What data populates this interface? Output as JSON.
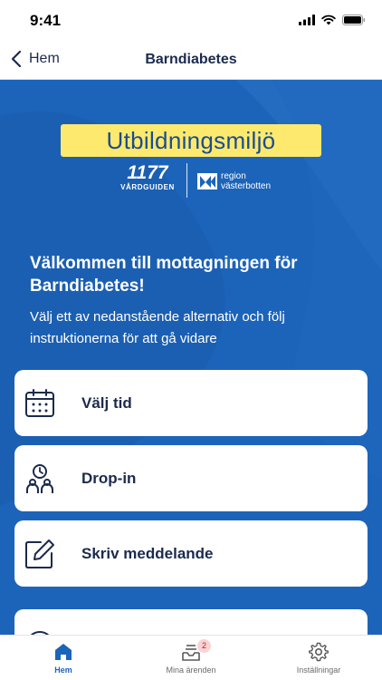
{
  "status_bar": {
    "time": "9:41"
  },
  "nav": {
    "back_label": "Hem",
    "title": "Barndiabetes"
  },
  "banner": {
    "text": "Utbildningsmiljö"
  },
  "logos": {
    "left_number": "1177",
    "left_sub": "VÅRDGUIDEN",
    "right_line1": "region",
    "right_line2": "västerbotten"
  },
  "welcome": {
    "title": "Välkommen till mottagningen för Barndiabetes!",
    "subtitle": "Välj ett av nedanstående alternativ och följ instruktionerna för att gå vidare"
  },
  "options": [
    {
      "label": "Välj tid",
      "icon": "calendar-icon"
    },
    {
      "label": "Drop-in",
      "icon": "drop-in-icon"
    },
    {
      "label": "Skriv meddelande",
      "icon": "edit-icon"
    },
    {
      "label": "",
      "icon": "clock-icon"
    }
  ],
  "tabs": [
    {
      "label": "Hem",
      "icon": "home-icon",
      "active": true
    },
    {
      "label": "Mina ärenden",
      "icon": "inbox-icon",
      "badge": "2"
    },
    {
      "label": "Inställningar",
      "icon": "gear-icon"
    }
  ],
  "colors": {
    "primary": "#1c64b9",
    "banner": "#fde96d",
    "text_dark": "#1b2a4e"
  }
}
